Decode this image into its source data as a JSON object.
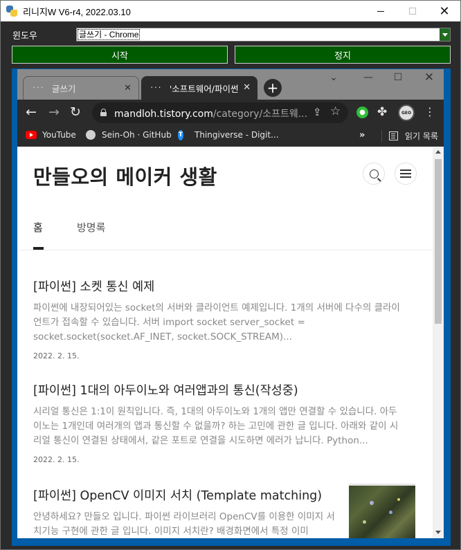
{
  "app": {
    "title": "리니지W V6-r4, 2022.03.10",
    "window_label": "윈도우",
    "window_selected": "글쓰기 - Chrome",
    "start_label": "시작",
    "stop_label": "정지",
    "close_glyph": "✕"
  },
  "chrome": {
    "tabs": [
      {
        "label": "글쓰기",
        "favicon": "᛫᛫᛫"
      },
      {
        "label": "'소프트웨어/파이썬",
        "favicon": "᛫᛫᛫"
      }
    ],
    "tab_close_glyph": "✕",
    "new_tab_glyph": "+",
    "url_host": "mandloh.tistory.com",
    "url_path": "/category/소프트웨...",
    "bookmarks": [
      {
        "label": "YouTube",
        "icon": "youtube-icon"
      },
      {
        "label": "Sein-Oh · GitHub",
        "icon": "github-icon"
      },
      {
        "label": "Thingiverse - Digit...",
        "icon": "thingiverse-icon"
      }
    ],
    "bookmarks_more": "»",
    "reading_list_label": "읽기 목록",
    "profile_text": "GEO",
    "colors": {
      "tabstrip": "#8a8a8a",
      "toolbar": "#2b2b2b",
      "app_button": "#005a00",
      "preview_border": "#005da8"
    }
  },
  "blog": {
    "title": "만들오의 메이커 생활",
    "nav": [
      "홈",
      "방명록"
    ],
    "posts": [
      {
        "title": "[파이썬] 소켓 통신 예제",
        "summary": "파이썬에 내장되어있는 socket의 서버와 클라이언트 예제입니다. 1개의 서버에 다수의 클라이언트가 접속할 수 있습니다. 서버 import socket server_socket = socket.socket(socket.AF_INET, socket.SOCK_STREAM)...",
        "date": "2022. 2. 15."
      },
      {
        "title": "[파이썬] 1대의 아두이노와 여러앱과의 통신(작성중)",
        "summary": "시리얼 통신은 1:1이 원칙입니다. 즉, 1대의 아두이노와 1개의 앱만 연결할 수 있습니다. 아두이노는 1개인데 여러개의 앱과 통신할 수 없을까? 하는 고민에 관한 글 입니다. 아래와 같이 시리얼 통신이 연결된 상태에서, 같은 포트로 연결을 시도하면 에러가 납니다. Python...",
        "date": "2022. 2. 15."
      },
      {
        "title": "[파이썬] OpenCV 이미지 서치 (Template matching)",
        "summary": "안녕하세요? 만들오 입니다. 파이썬 라이브러리 OpenCV를 이용한 이미지 서치기능 구현에 관한 글 입니다. 이미지 서치란? 배경화면에서 특정 이미",
        "date": ""
      }
    ]
  }
}
